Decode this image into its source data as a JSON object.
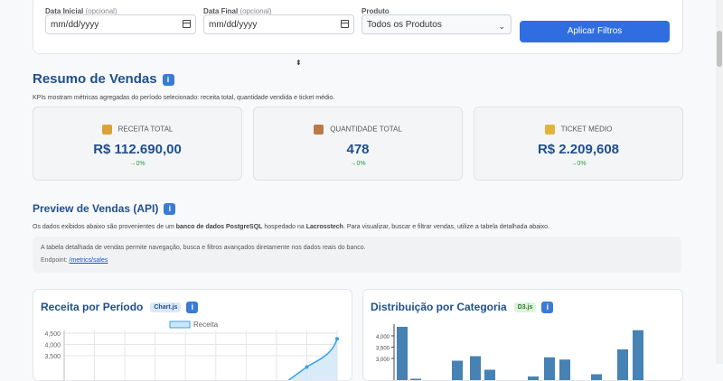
{
  "filters": {
    "start_label": "Data Inicial",
    "start_opt": "(opcional)",
    "start_value": "mm/dd/yyyy",
    "end_label": "Data Final",
    "end_opt": "(opcional)",
    "end_value": "mm/dd/yyyy",
    "product_label": "Produto",
    "product_value": "Todos os Produtos",
    "apply_label": "Aplicar Filtros",
    "apply_color": "#2f6de1"
  },
  "summary": {
    "title": "Resumo de Vendas",
    "info_glyph": "i",
    "desc": "KPIs mostram métricas agregadas do período selecionado: receita total, quantidade vendida e ticket médio.",
    "kpis": [
      {
        "label": "RECEITA TOTAL",
        "value": "R$ 112.690,00",
        "delta": "→0%",
        "icon": "money-bag-icon",
        "icon_color": "#d9a23a"
      },
      {
        "label": "QUANTIDADE TOTAL",
        "value": "478",
        "delta": "→0%",
        "icon": "package-icon",
        "icon_color": "#b97a4a"
      },
      {
        "label": "TICKET MÉDIO",
        "value": "R$ 2.209,608",
        "delta": "→0%",
        "icon": "ticket-icon",
        "icon_color": "#e2b33c"
      }
    ]
  },
  "preview": {
    "title": "Preview de Vendas (API)",
    "desc_1": "Os dados exibidos abaixo são provenientes de um ",
    "desc_bold_1": "banco de dados PostgreSQL",
    "desc_2": " hospedado na ",
    "desc_bold_2": "Lacrosstech",
    "desc_3": ". Para visualizar, buscar e filtrar vendas, utilize a tabela detalhada abaixo.",
    "box_text": "A tabela detalhada de vendas permite navegação, busca e filtros avançados diretamente nos dados reais do banco.",
    "endpoint_label": "Endpoint:",
    "endpoint_value": "/metrics/sales"
  },
  "charts": {
    "left_title": "Receita por Período",
    "left_badge": "Chart.js",
    "right_title": "Distribuição por Categoria",
    "right_badge": "D3.js"
  },
  "chart_data": [
    {
      "type": "line",
      "title": "Receita por Período",
      "series": [
        {
          "name": "Receita",
          "values": [
            null,
            null,
            null,
            null,
            null,
            null,
            null,
            null,
            3000,
            4250
          ]
        }
      ],
      "y_ticks": [
        "4,500",
        "4,000",
        "3,500"
      ],
      "ylim": [
        3000,
        4500
      ],
      "grid": true,
      "legend": "top-center",
      "color": "#36a2eb"
    },
    {
      "type": "bar",
      "title": "Distribuição por Categoria",
      "values": [
        4400,
        2100,
        1800,
        2900,
        3100,
        2500,
        2200,
        3050,
        2950,
        2300,
        3400,
        4250
      ],
      "y_ticks": [
        "4,000",
        "3,500",
        "3,000"
      ],
      "ylim": [
        2800,
        4500
      ],
      "color": "#4682b4"
    }
  ]
}
